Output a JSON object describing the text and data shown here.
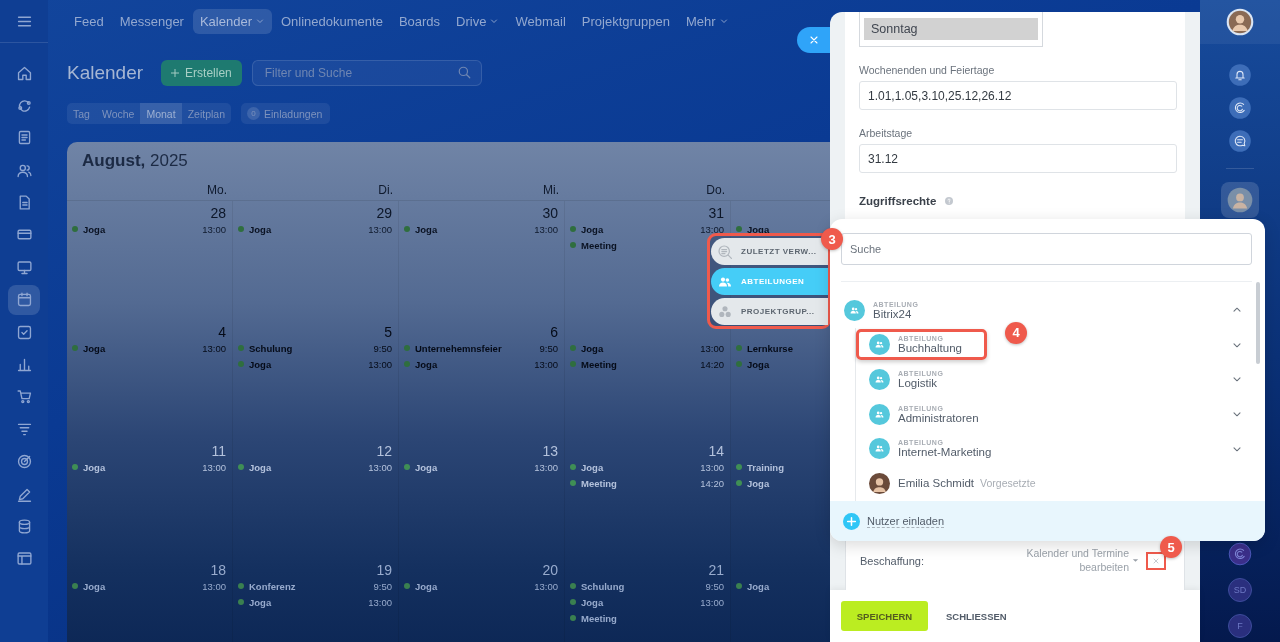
{
  "sidebar": {
    "items": [
      {
        "kind": "home",
        "selected": false
      },
      {
        "kind": "cycle",
        "selected": false
      },
      {
        "kind": "newspaper",
        "selected": false
      },
      {
        "kind": "people",
        "selected": false
      },
      {
        "kind": "document",
        "selected": false
      },
      {
        "kind": "card",
        "selected": false
      },
      {
        "kind": "monitor",
        "selected": false
      },
      {
        "kind": "calendar",
        "selected": true
      },
      {
        "kind": "checkbox",
        "selected": false
      },
      {
        "kind": "chart",
        "selected": false
      },
      {
        "kind": "cart",
        "selected": false
      },
      {
        "kind": "funnel",
        "selected": false
      },
      {
        "kind": "target",
        "selected": false
      },
      {
        "kind": "pen",
        "selected": false
      },
      {
        "kind": "database",
        "selected": false
      },
      {
        "kind": "window",
        "selected": false
      }
    ]
  },
  "top_nav": {
    "items": [
      {
        "label": "Feed",
        "selected": false,
        "dropdown": false
      },
      {
        "label": "Messenger",
        "selected": false,
        "dropdown": false
      },
      {
        "label": "Kalender",
        "selected": true,
        "dropdown": true
      },
      {
        "label": "Onlinedokumente",
        "selected": false,
        "dropdown": false
      },
      {
        "label": "Boards",
        "selected": false,
        "dropdown": false
      },
      {
        "label": "Drive",
        "selected": false,
        "dropdown": true
      },
      {
        "label": "Webmail",
        "selected": false,
        "dropdown": false
      },
      {
        "label": "Projektgruppen",
        "selected": false,
        "dropdown": false
      },
      {
        "label": "Mehr",
        "selected": false,
        "dropdown": true
      }
    ]
  },
  "header": {
    "title": "Kalender",
    "create_button": "Erstellen",
    "filter": {
      "placeholder": "Filter und Suche"
    },
    "view_tabs": [
      {
        "label": "Tag",
        "selected": false
      },
      {
        "label": "Woche",
        "selected": false
      },
      {
        "label": "Monat",
        "selected": true
      },
      {
        "label": "Zeitplan",
        "selected": false
      }
    ],
    "invitations": {
      "count": "0",
      "label": "Einladungen"
    }
  },
  "calendar": {
    "month_title": "**August,** 2025",
    "weekdays": [
      "Mo.",
      "Di.",
      "Mi.",
      "Do."
    ],
    "weeks": [
      {
        "days": [
          {
            "date": "28",
            "events": [
              {
                "title": "Joga",
                "time": "13:00"
              }
            ]
          },
          {
            "date": "29",
            "events": [
              {
                "title": "Joga",
                "time": "13:00"
              }
            ]
          },
          {
            "date": "30",
            "events": [
              {
                "title": "Joga",
                "time": "13:00"
              }
            ]
          },
          {
            "date": "31",
            "events": [
              {
                "title": "Joga",
                "time": "13:00"
              },
              {
                "title": "Meeting"
              }
            ]
          },
          {
            "events": [
              {
                "title": "Joga"
              }
            ]
          }
        ]
      },
      {
        "days": [
          {
            "date": "4",
            "events": [
              {
                "title": "Joga",
                "time": "13:00"
              }
            ]
          },
          {
            "date": "5",
            "events": [
              {
                "title": "Schulung",
                "time": "9:50"
              },
              {
                "title": "Joga",
                "time": "13:00"
              }
            ]
          },
          {
            "date": "6",
            "events": [
              {
                "title": "Unternehemnsfeier",
                "time": "9:50"
              },
              {
                "title": "Joga",
                "time": "13:00"
              }
            ]
          },
          {
            "events": [
              {
                "title": "Joga",
                "time": "13:00"
              },
              {
                "title": "Meeting",
                "time": "14:20"
              }
            ]
          },
          {
            "events": [
              {
                "title": "Lernkurse"
              },
              {
                "title": "Joga"
              }
            ]
          }
        ]
      },
      {
        "days": [
          {
            "date": "11",
            "events": [
              {
                "title": "Joga",
                "time": "13:00"
              }
            ]
          },
          {
            "date": "12",
            "events": [
              {
                "title": "Joga",
                "time": "13:00"
              }
            ]
          },
          {
            "date": "13",
            "events": [
              {
                "title": "Joga",
                "time": "13:00"
              }
            ]
          },
          {
            "date": "14",
            "events": [
              {
                "title": "Joga",
                "time": "13:00"
              },
              {
                "title": "Meeting",
                "time": "14:20"
              }
            ]
          },
          {
            "events": [
              {
                "title": "Training"
              },
              {
                "title": "Joga"
              }
            ]
          }
        ]
      },
      {
        "days": [
          {
            "date": "18",
            "events": [
              {
                "title": "Joga",
                "time": "13:00"
              }
            ]
          },
          {
            "date": "19",
            "events": [
              {
                "title": "Konferenz",
                "time": "9:50"
              },
              {
                "title": "Joga",
                "time": "13:00"
              }
            ]
          },
          {
            "date": "20",
            "events": [
              {
                "title": "Joga",
                "time": "13:00"
              }
            ]
          },
          {
            "date": "21",
            "events": [
              {
                "title": "Schulung",
                "time": "9:50"
              },
              {
                "title": "Joga",
                "time": "13:00"
              },
              {
                "title": "Meeting"
              }
            ]
          },
          {
            "events": [
              {
                "title": "Joga"
              }
            ]
          }
        ]
      }
    ]
  },
  "panel": {
    "weekday_list": {
      "options": [
        {
          "label": "Sonntag",
          "selected": true
        }
      ]
    },
    "fields": [
      {
        "label": "Wochenenden und Feiertage",
        "value": "1.01,1.05,3.10,25.12,26.12"
      },
      {
        "label": "Arbeitstage",
        "value": "31.12"
      }
    ],
    "access_title": "Zugriffsrechte",
    "permission_row": {
      "label": "Beschaffung:",
      "value": "Kalender und Termine bearbeiten",
      "remove_badge": "5"
    },
    "buttons": [
      {
        "label": "SPEICHERN",
        "kind": "primary"
      },
      {
        "label": "SCHLIESSEN",
        "kind": "link"
      }
    ]
  },
  "selector": {
    "tabs_badge": "3",
    "tabs": [
      {
        "label": "ZULETZT VERW...",
        "kind": "recent",
        "selected": false
      },
      {
        "label": "ABTEILUNGEN",
        "kind": "departments",
        "selected": true
      },
      {
        "label": "PROJEKTGRUP...",
        "kind": "projects",
        "selected": false
      }
    ],
    "search": {
      "placeholder": "Suche"
    },
    "tree": [
      {
        "kind": "department",
        "type_label": "ABTEILUNG",
        "name": "Bitrix24",
        "expanded": true,
        "children": [
          {
            "kind": "department",
            "type_label": "ABTEILUNG",
            "name": "Buchhaltung",
            "expanded": false,
            "badge": "4"
          },
          {
            "kind": "department",
            "type_label": "ABTEILUNG",
            "name": "Logistik",
            "expanded": false
          },
          {
            "kind": "department",
            "type_label": "ABTEILUNG",
            "name": "Administratoren",
            "expanded": false
          },
          {
            "kind": "department",
            "type_label": "ABTEILUNG",
            "name": "Internet-Marketing",
            "expanded": false
          },
          {
            "kind": "user",
            "name": "Emilia Schmidt",
            "role": "Vorgesetzte"
          }
        ]
      }
    ],
    "invite": "Nutzer einladen"
  },
  "right_rail": {
    "initials": [
      "SD",
      "F"
    ]
  }
}
